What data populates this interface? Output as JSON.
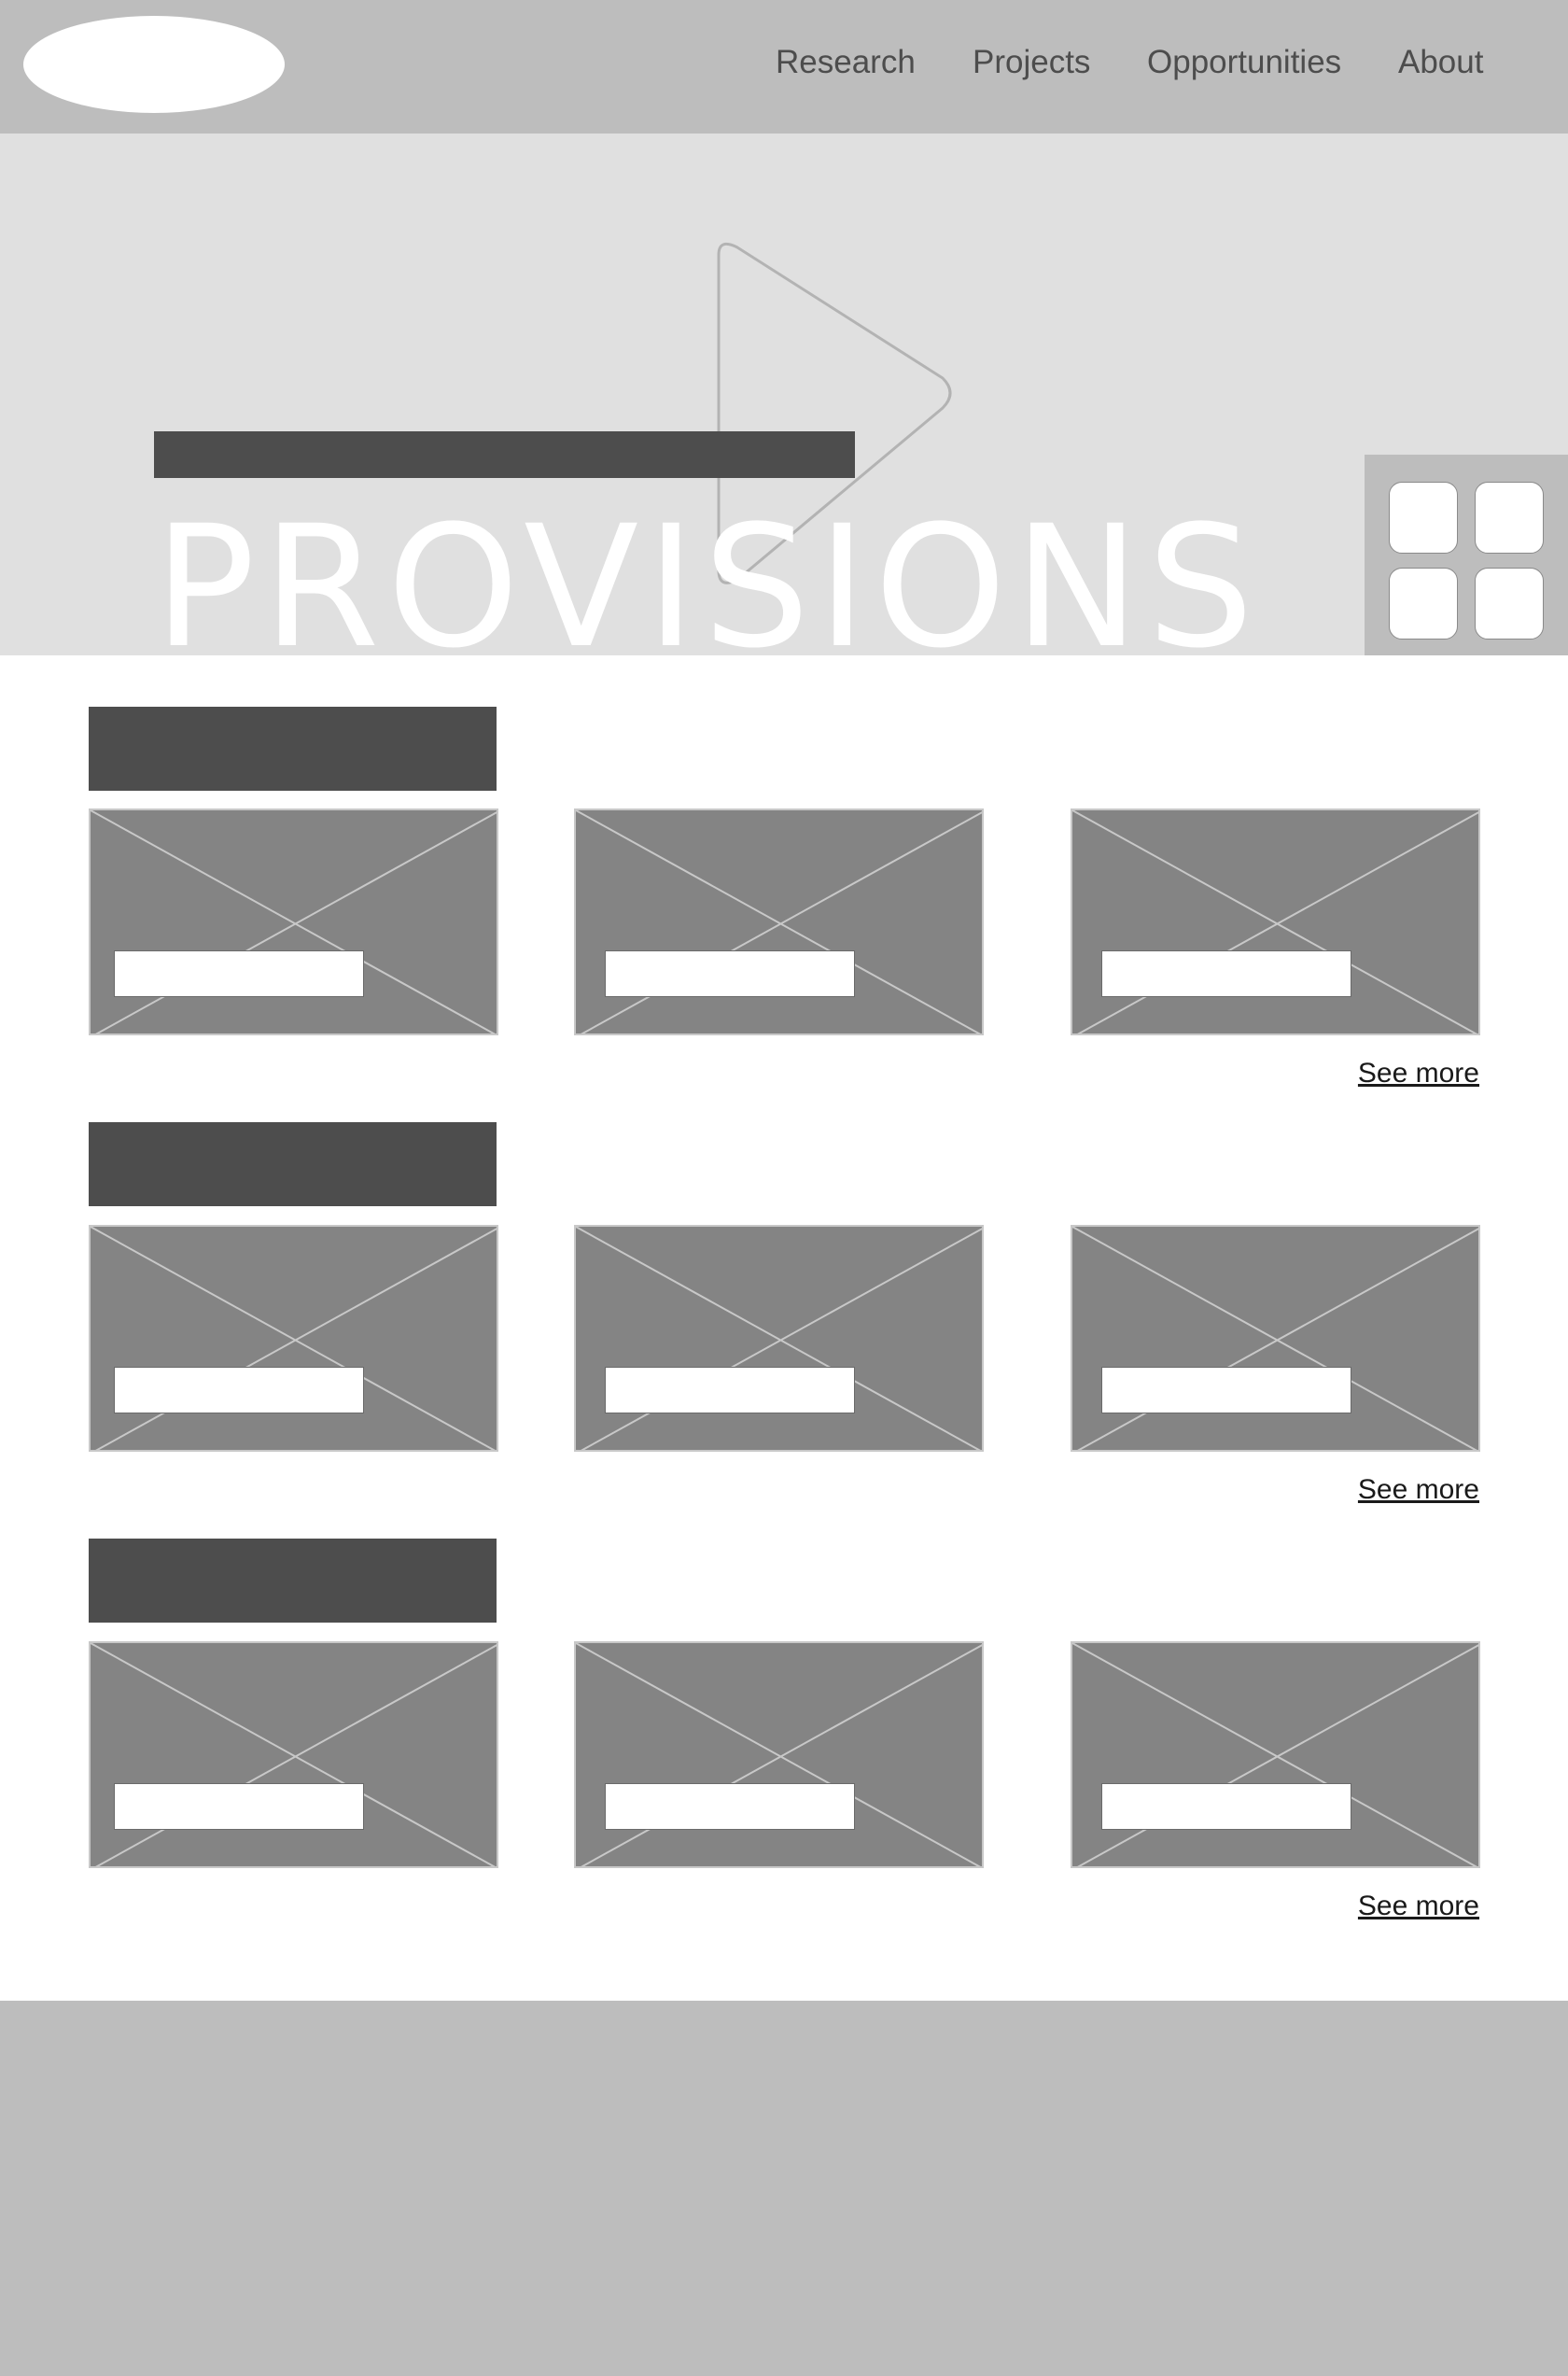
{
  "header": {
    "logo_icon": "logo-ellipse",
    "nav": [
      {
        "label": "Research"
      },
      {
        "label": "Projects"
      },
      {
        "label": "Opportunities"
      },
      {
        "label": "About"
      }
    ]
  },
  "hero": {
    "title": "PROVISIONS",
    "play_icon": "play-icon",
    "grid_icon": "grid-icon"
  },
  "sections": [
    {
      "see_more": "See more",
      "card_count": 3
    },
    {
      "see_more": "See more",
      "card_count": 3
    },
    {
      "see_more": "See more",
      "card_count": 3
    }
  ],
  "colors": {
    "header_bg": "#bdbdbd",
    "hero_bg": "#e0e0e0",
    "heading_block": "#4d4d4d",
    "card_bg": "#848484"
  }
}
